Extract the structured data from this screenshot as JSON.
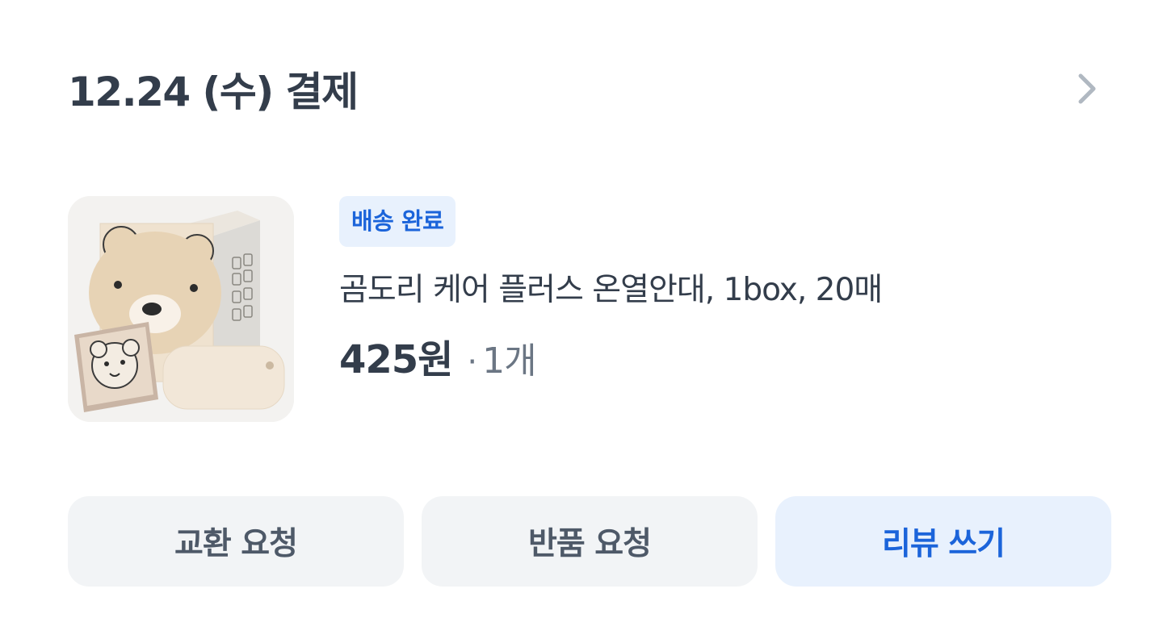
{
  "order": {
    "date_title": "12.24 (수) 결제",
    "detail_icon": "chevron-right-icon"
  },
  "product": {
    "status_badge": "배송 완료",
    "name": "곰도리 케어 플러스 온열안대, 1box, 20매",
    "price": "425원",
    "separator": "·",
    "quantity": "1개",
    "image": "bear-eye-mask-box-product-image"
  },
  "actions": {
    "exchange_label": "교환 요청",
    "return_label": "반품 요청",
    "review_label": "리뷰 쓰기"
  },
  "colors": {
    "text_primary": "#333d4b",
    "text_secondary": "#6b7684",
    "accent_blue": "#1b64da",
    "accent_blue_bg": "#e8f1fd",
    "button_gray_bg": "#f2f4f6"
  }
}
